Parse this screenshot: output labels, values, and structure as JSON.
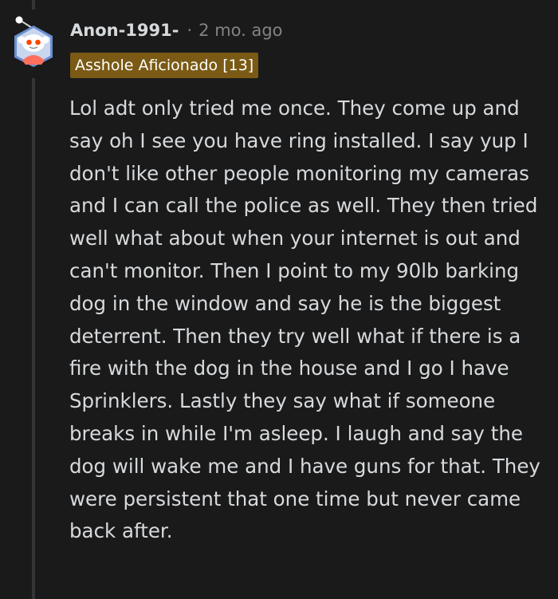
{
  "comment": {
    "author": "Anon-1991-",
    "separator": "·",
    "timestamp": "2 mo. ago",
    "flair": "Asshole Aficionado [13]",
    "body": "Lol adt only tried me once. They come up and say oh I see you have ring installed. I say yup I don't like other people monitoring my cameras and I can call the police as well. They then tried well what about when your internet is out and can't monitor. Then I point to my 90lb barking dog in the window and say he is the biggest deterrent. Then they try well what if there is a fire with the dog in the house and I go I have Sprinklers. Lastly they say what if someone breaks in while I'm asleep. I laugh and say the dog will wake me and I have guns for that. They were persistent that one time but never came back after."
  },
  "avatar": {
    "icon": "snoo-avatar-icon",
    "colors": {
      "frame": "#6a8fd0",
      "face": "#ffffff",
      "eyes": "#ff4500",
      "shirt": "#ff6f5e"
    }
  },
  "theme": {
    "background": "#1a1a1b",
    "text": "#d7dadc",
    "muted": "#818384",
    "flair_bg": "#7a5a14",
    "thread_line": "#343536"
  }
}
